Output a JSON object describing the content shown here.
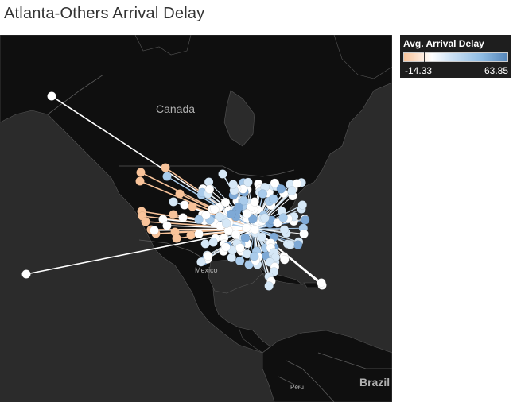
{
  "title": "Atlanta-Others Arrival Delay",
  "legend": {
    "title": "Avg. Arrival Delay",
    "min": "-14.33",
    "max": "63.85",
    "colors": [
      "#f8c39a",
      "#ffffff",
      "#cfe3f5",
      "#8fbce3",
      "#5585b8"
    ]
  },
  "map_labels": {
    "canada": "Canada",
    "mexico": "Mexico",
    "peru": "Peru",
    "brazil": "Brazil"
  },
  "colors": {
    "ocean": "#2b2b2b",
    "land": "#0f0f0f",
    "border": "#5a5a5a",
    "route_line": "#ffffff"
  }
}
